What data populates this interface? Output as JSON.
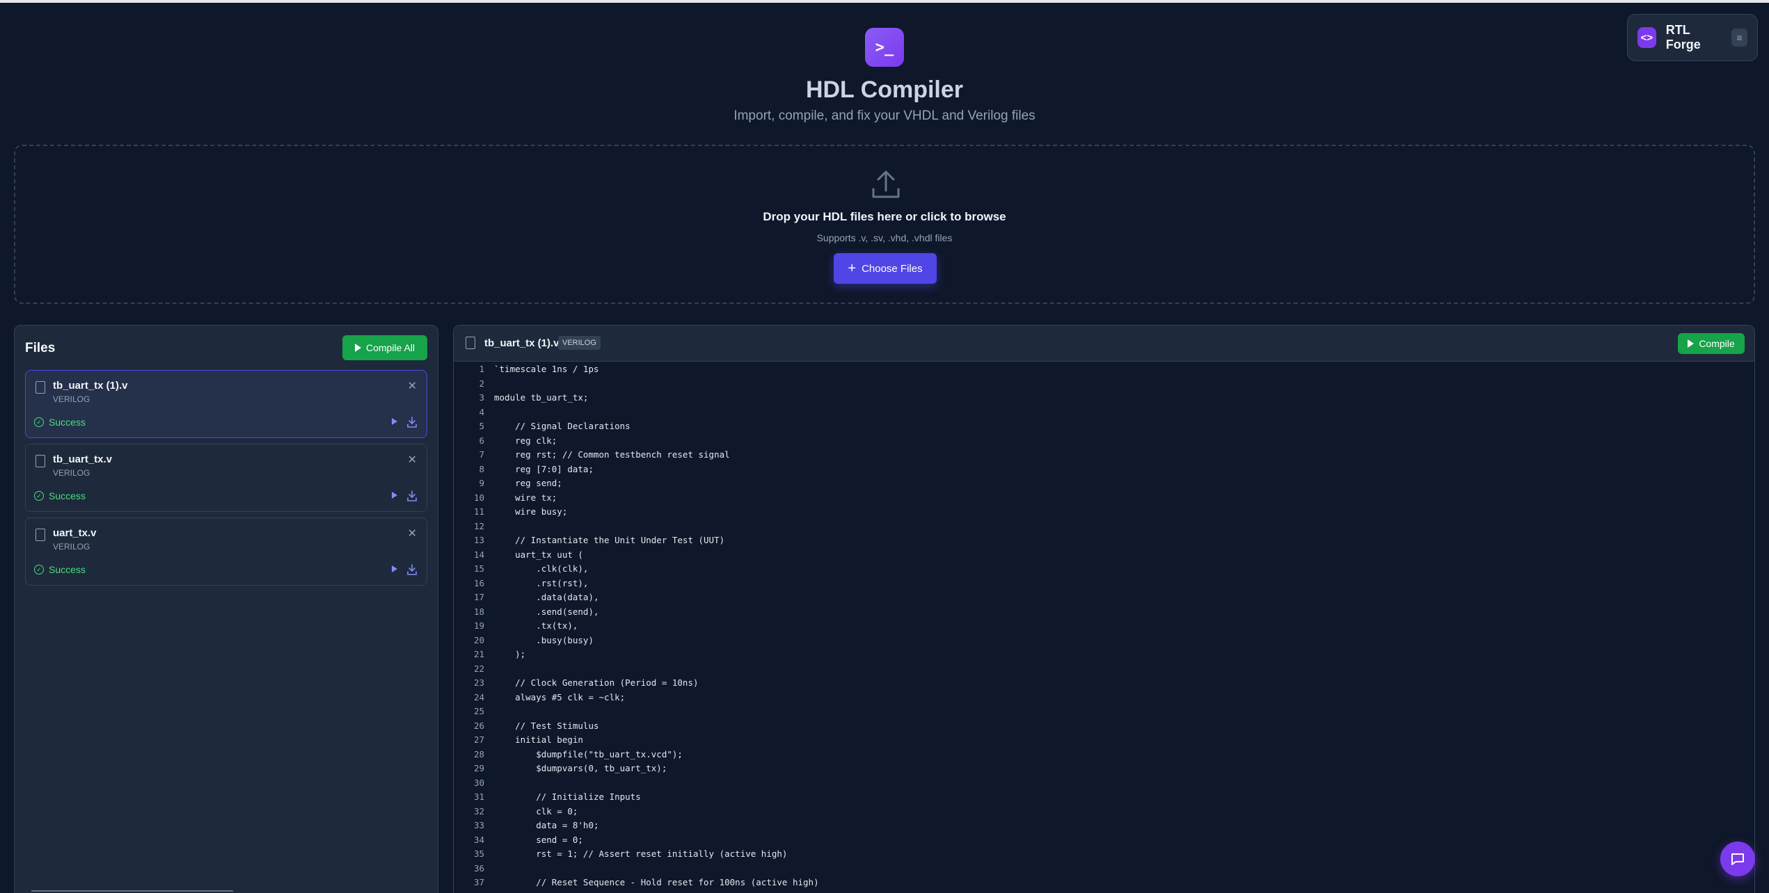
{
  "brand": {
    "name": "RTL Forge",
    "icon": "code-icon",
    "menu_icon": "menu-icon"
  },
  "header": {
    "icon": "terminal-icon",
    "icon_glyph": ">_",
    "title": "HDL Compiler",
    "subtitle": "Import, compile, and fix your VHDL and Verilog files"
  },
  "dropzone": {
    "icon": "upload-icon",
    "title": "Drop your HDL files here or click to browse",
    "subtitle": "Supports .v, .sv, .vhd, .vhdl files",
    "button_label": "Choose Files"
  },
  "files": {
    "title": "Files",
    "compile_all_label": "Compile All",
    "items": [
      {
        "name": "tb_uart_tx (1).v",
        "language": "VERILOG",
        "status": "Success",
        "active": true
      },
      {
        "name": "tb_uart_tx.v",
        "language": "VERILOG",
        "status": "Success",
        "active": false
      },
      {
        "name": "uart_tx.v",
        "language": "VERILOG",
        "status": "Success",
        "active": false
      }
    ]
  },
  "editor": {
    "filename": "tb_uart_tx (1).v",
    "language": "VERILOG",
    "compile_label": "Compile",
    "lines": [
      "`timescale 1ns / 1ps",
      "",
      "module tb_uart_tx;",
      "",
      "    // Signal Declarations",
      "    reg clk;",
      "    reg rst; // Common testbench reset signal",
      "    reg [7:0] data;",
      "    reg send;",
      "    wire tx;",
      "    wire busy;",
      "",
      "    // Instantiate the Unit Under Test (UUT)",
      "    uart_tx uut (",
      "        .clk(clk),",
      "        .rst(rst),",
      "        .data(data),",
      "        .send(send),",
      "        .tx(tx),",
      "        .busy(busy)",
      "    );",
      "",
      "    // Clock Generation (Period = 10ns)",
      "    always #5 clk = ~clk;",
      "",
      "    // Test Stimulus",
      "    initial begin",
      "        $dumpfile(\"tb_uart_tx.vcd\");",
      "        $dumpvars(0, tb_uart_tx);",
      "",
      "        // Initialize Inputs",
      "        clk = 0;",
      "        data = 8'h0;",
      "        send = 0;",
      "        rst = 1; // Assert reset initially (active high)",
      "",
      "        // Reset Sequence - Hold reset for 100ns (active high)"
    ]
  },
  "chat": {
    "icon": "chat-icon"
  }
}
